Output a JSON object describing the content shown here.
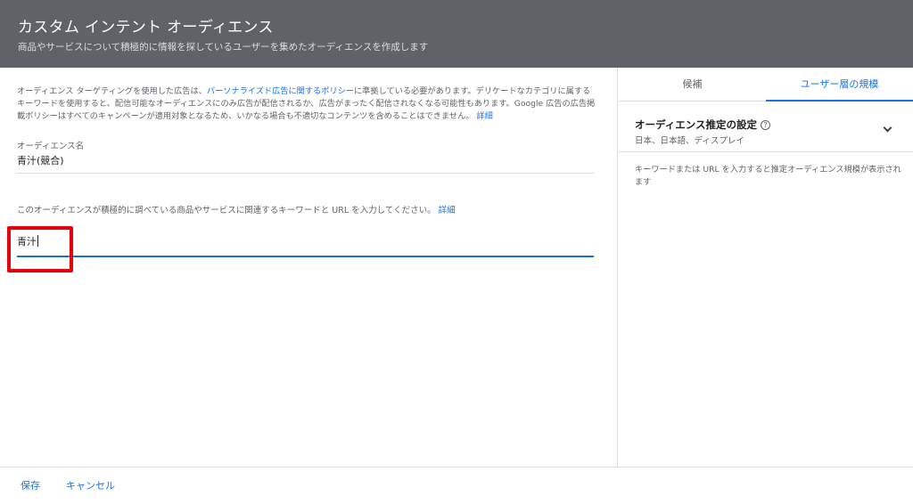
{
  "header": {
    "title": "カスタム インテント オーディエンス",
    "subtitle": "商品やサービスについて積極的に情報を探しているユーザーを集めたオーディエンスを作成します"
  },
  "policy": {
    "text_1": "オーディエンス ターゲティングを使用した広告は、",
    "link_policy": "パーソナライズド広告に関するポリシー",
    "text_2": "に準拠している必要があります。デリケートなカテゴリに属するキーワードを使用すると、配信可能なオーディエンスにのみ広告が配信されるか、広告がまったく配信されなくなる可能性もあります。Google 広告の広告掲載ポリシーはすべてのキャンペーンが適用対象となるため、いかなる場合も不適切なコンテンツを含めることはできません。",
    "link_details": "詳細"
  },
  "audience_name": {
    "label": "オーディエンス名",
    "value": "青汁(競合)"
  },
  "keywords": {
    "prompt": "このオーディエンスが積極的に調べている商品やサービスに関連するキーワードと URL を入力してください。",
    "link_details": "詳細",
    "value": "青汁"
  },
  "side": {
    "tabs": [
      {
        "label": "候補"
      },
      {
        "label": "ユーザー層の規模"
      }
    ],
    "estimate_title": "オーディエンス推定の設定",
    "estimate_help_icon": "?",
    "estimate_subtitle": "日本、日本語、ディスプレイ",
    "estimate_note": "キーワードまたは URL を入力すると推定オーディエンス規模が表示されます"
  },
  "footer": {
    "save_label": "保存",
    "cancel_label": "キャンセル"
  },
  "colors": {
    "header_bg": "#5f6368",
    "accent": "#1a73e8",
    "highlight": "#e8000b"
  }
}
